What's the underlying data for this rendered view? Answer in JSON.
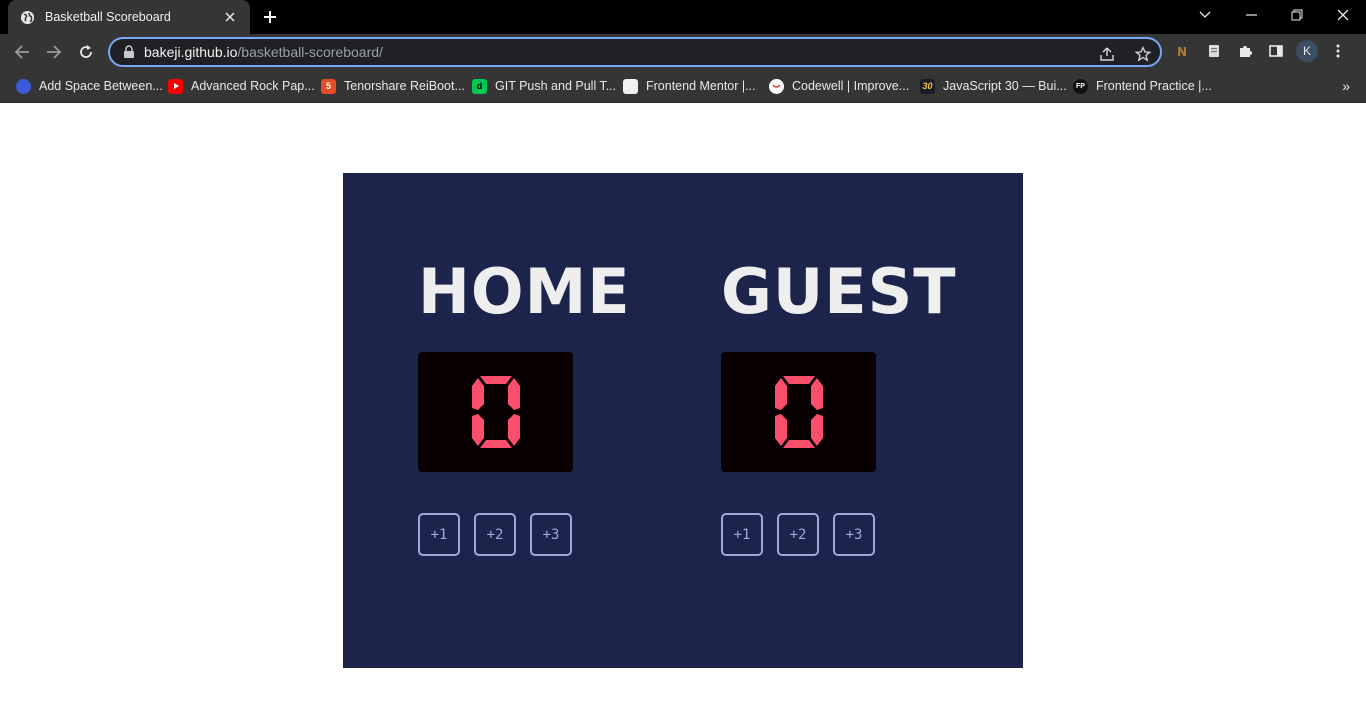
{
  "browser": {
    "tab_title": "Basketball Scoreboard",
    "url_host": "bakeji.github.io",
    "url_path": "/basketball-scoreboard/",
    "profile_initial": "K",
    "bookmarks": [
      {
        "label": "Add Space Between...",
        "icon": "gear-icon",
        "color": "#3a5bd9"
      },
      {
        "label": "Advanced Rock Pap...",
        "icon": "youtube-icon",
        "color": "#ff0000"
      },
      {
        "label": "Tenorshare ReiBoot...",
        "icon": "html5-icon",
        "color": "#e44d26"
      },
      {
        "label": "GIT Push and Pull T...",
        "icon": "dev-icon",
        "color": "#00c853"
      },
      {
        "label": "Frontend Mentor |...",
        "icon": "page-icon",
        "color": "#f1f1f1"
      },
      {
        "label": "Codewell | Improve...",
        "icon": "codewell-icon",
        "color": "#ffffff"
      },
      {
        "label": "JavaScript 30 — Bui...",
        "icon": "js30-icon",
        "color": "#1b1b2b"
      },
      {
        "label": "Frontend Practice |...",
        "icon": "fp-icon",
        "color": "#111111"
      }
    ]
  },
  "scoreboard": {
    "home": {
      "name": "HOME",
      "score": "0",
      "buttons": [
        "+1",
        "+2",
        "+3"
      ]
    },
    "guest": {
      "name": "GUEST",
      "score": "0",
      "buttons": [
        "+1",
        "+2",
        "+3"
      ]
    }
  },
  "colors": {
    "board_bg": "#1c244b",
    "score_bg": "#080001",
    "score_digit": "#f94f6d",
    "button_border": "#9aabd8",
    "team_text": "#eeeeee"
  }
}
